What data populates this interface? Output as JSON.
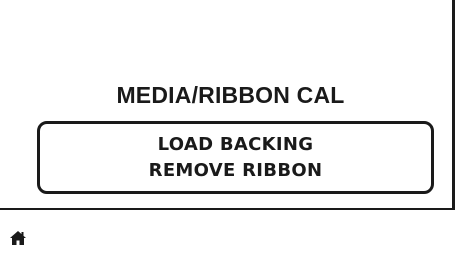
{
  "screen": {
    "title": "MEDIA/RIBBON CAL",
    "message_lines": [
      "LOAD BACKING",
      "REMOVE RIBBON"
    ]
  },
  "footer": {
    "home_icon": "home-icon"
  },
  "colors": {
    "foreground": "#1a1a1a",
    "background": "#ffffff"
  }
}
